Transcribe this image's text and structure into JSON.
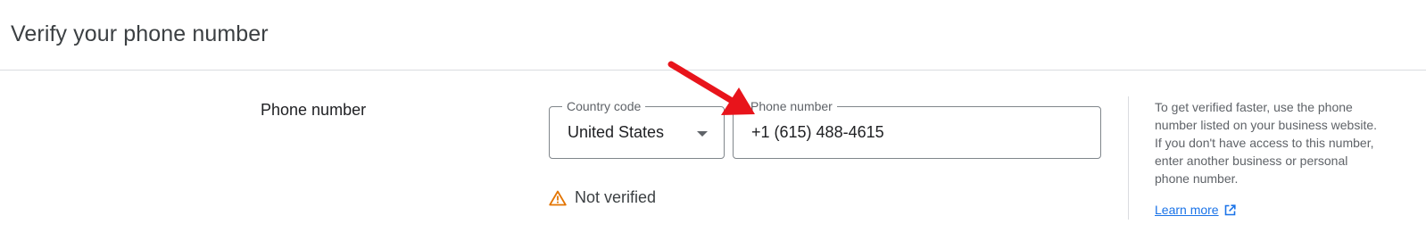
{
  "header": {
    "title": "Verify your phone number"
  },
  "phone_section": {
    "label": "Phone number",
    "country_code": {
      "label": "Country code",
      "value": "United States"
    },
    "phone_number": {
      "label": "Phone number",
      "value": "+1 (615) 488-4615"
    },
    "status": {
      "text": "Not verified",
      "icon": "warning-icon",
      "color": "#e37400"
    }
  },
  "helper": {
    "text": "To get verified faster, use the phone number listed on your business website. If you don't have access to this number, enter another business or personal phone number.",
    "link_label": "Learn more",
    "link_icon": "external-link-icon",
    "link_color": "#1a73e8"
  },
  "annotation": {
    "type": "arrow",
    "color": "#e8141b"
  }
}
